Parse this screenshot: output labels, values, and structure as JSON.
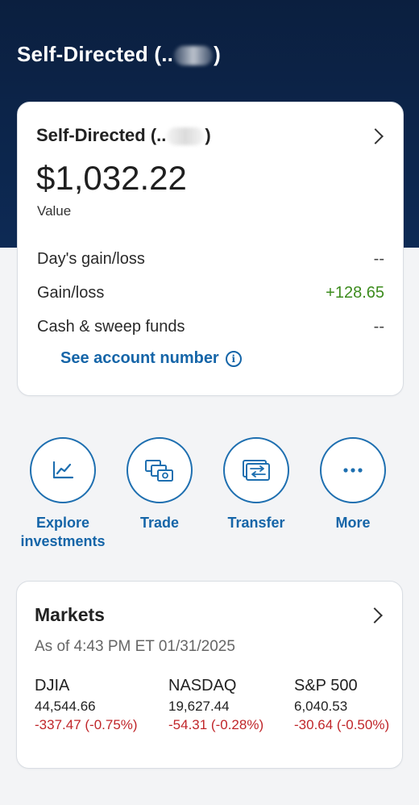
{
  "header": {
    "title_prefix": "Self-Directed (..",
    "title_suffix": ")"
  },
  "account": {
    "name_prefix": "Self-Directed (..",
    "name_suffix": ")",
    "value": "$1,032.22",
    "value_label": "Value",
    "rows": [
      {
        "label": "Day's gain/loss",
        "value": "--"
      },
      {
        "label": "Gain/loss",
        "value": "+128.65"
      },
      {
        "label": "Cash & sweep funds",
        "value": "--"
      }
    ],
    "see_account_number": "See account number",
    "info_glyph": "i"
  },
  "actions": [
    {
      "label": "Explore investments",
      "icon": "chart-line-icon"
    },
    {
      "label": "Trade",
      "icon": "trade-icon"
    },
    {
      "label": "Transfer",
      "icon": "transfer-icon"
    },
    {
      "label": "More",
      "icon": "more-dots-icon"
    }
  ],
  "markets": {
    "title": "Markets",
    "as_of": "As of 4:43 PM ET 01/31/2025",
    "indices": [
      {
        "name": "DJIA",
        "value": "44,544.66",
        "change": "-337.47 (-0.75%)"
      },
      {
        "name": "NASDAQ",
        "value": "19,627.44",
        "change": "-54.31 (-0.28%)"
      },
      {
        "name": "S&P 500",
        "value": "6,040.53",
        "change": "-30.64 (-0.50%)"
      }
    ]
  },
  "colors": {
    "header_bg": "#0b1f3f",
    "link_blue": "#1565a8",
    "positive_green": "#3d8c1e",
    "negative_red": "#c0262a"
  }
}
